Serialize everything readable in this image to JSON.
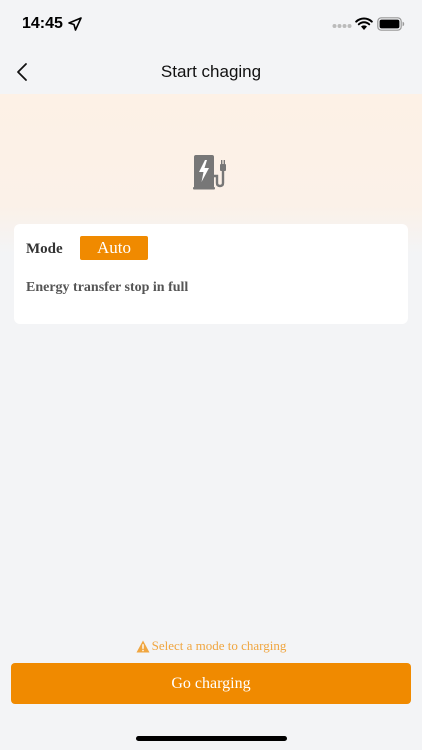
{
  "status_bar": {
    "time": "14:45",
    "icons": [
      "location-arrow-icon",
      "signal-icon",
      "wifi-icon",
      "battery-icon"
    ]
  },
  "nav": {
    "title": "Start chaging",
    "back_icon": "chevron-left-icon"
  },
  "hero": {
    "icon": "ev-charger-icon"
  },
  "mode_card": {
    "mode_label": "Mode",
    "mode_value": "Auto",
    "description": "Energy transfer stop in full"
  },
  "hint": {
    "icon": "warning-icon",
    "text": "Select a mode to charging"
  },
  "action": {
    "button_label": "Go charging"
  },
  "colors": {
    "accent": "#f08a00",
    "hint": "#f0a640",
    "background": "#f3f4f6",
    "hero_tint": "#fdf1e6"
  }
}
